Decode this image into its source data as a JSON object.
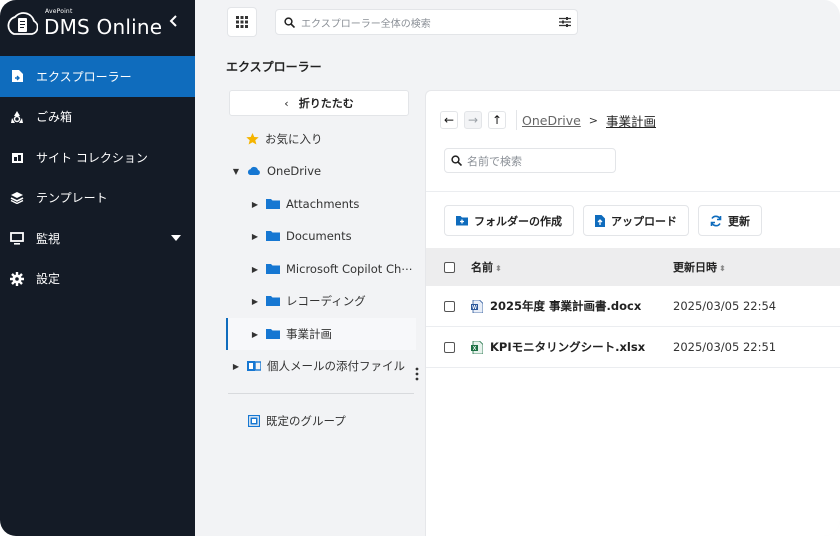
{
  "brand": {
    "sub": "AvePoint",
    "name": "DMS Online"
  },
  "nav": [
    {
      "label": "エクスプローラー",
      "icon": "explorer-icon",
      "active": true
    },
    {
      "label": "ごみ箱",
      "icon": "recycle-icon"
    },
    {
      "label": "サイト コレクション",
      "icon": "site-collection-icon"
    },
    {
      "label": "テンプレート",
      "icon": "layers-icon"
    },
    {
      "label": "監視",
      "icon": "monitor-icon",
      "expandable": true
    },
    {
      "label": "設定",
      "icon": "gear-icon"
    }
  ],
  "search": {
    "placeholder": "エクスプローラー全体の検索"
  },
  "page": {
    "title": "エクスプローラー"
  },
  "tree": {
    "fold_label": "折りたたむ",
    "favorites": "お気に入り",
    "onedrive": "OneDrive",
    "folders": [
      {
        "label": "Attachments"
      },
      {
        "label": "Documents"
      },
      {
        "label": "Microsoft Copilot Ch⋯"
      },
      {
        "label": "レコーディング"
      },
      {
        "label": "事業計画",
        "selected": true
      }
    ],
    "mail_attachments": "個人メールの添付ファイル",
    "default_group": "既定のグループ"
  },
  "breadcrumb": {
    "root": "OneDrive",
    "current": "事業計画"
  },
  "local_search": {
    "placeholder": "名前で検索"
  },
  "toolbar": {
    "create_folder": "フォルダーの作成",
    "upload": "アップロード",
    "refresh": "更新"
  },
  "table": {
    "columns": {
      "name": "名前",
      "modified": "更新日時"
    },
    "rows": [
      {
        "name": "2025年度 事業計画書.docx",
        "modified": "2025/03/05 22:54",
        "type": "word"
      },
      {
        "name": "KPIモニタリングシート.xlsx",
        "modified": "2025/03/05 22:51",
        "type": "excel"
      }
    ]
  },
  "colors": {
    "sidebar": "#141b26",
    "accent": "#0f6cbd",
    "folder": "#1677d2",
    "star": "#f5b400",
    "excel": "#1e7145",
    "word": "#2b579a"
  }
}
